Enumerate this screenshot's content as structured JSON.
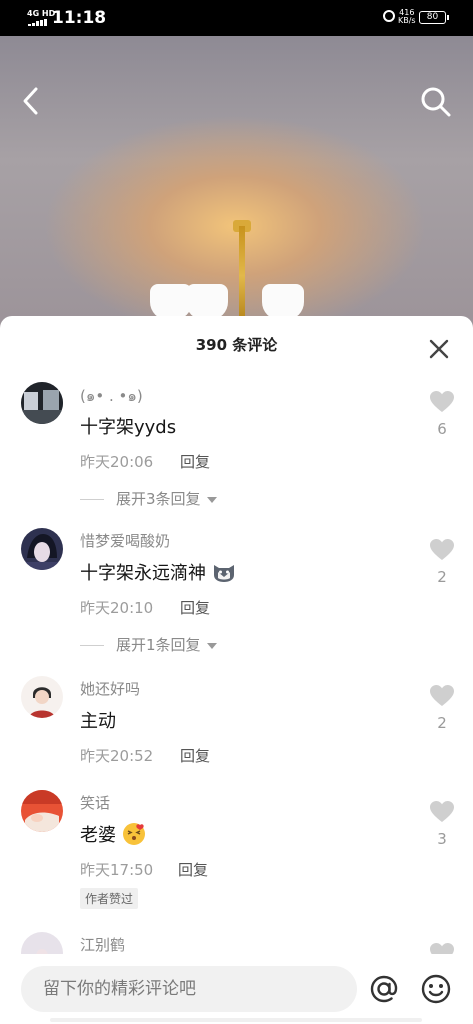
{
  "status_bar": {
    "network": "4G HD",
    "time": "11:18",
    "speed_value": "416",
    "speed_unit": "KB/s",
    "battery": "80"
  },
  "video": {
    "back_icon": "chevron-left-icon",
    "search_icon": "search-icon"
  },
  "comments_panel": {
    "title": "390 条评论",
    "close_icon": "close-icon",
    "comments": [
      {
        "username": "(๑• . •๑)",
        "text": "十字架yyds",
        "time": "昨天20:06",
        "reply_label": "回复",
        "likes": "6",
        "expand_label": "展开3条回复"
      },
      {
        "username": "惜梦爱喝酸奶",
        "text": "十字架永远滴神",
        "text_emoji": "cat-face-emoji",
        "time": "昨天20:10",
        "reply_label": "回复",
        "likes": "2",
        "expand_label": "展开1条回复"
      },
      {
        "username": "她还好吗",
        "text": "主动",
        "time": "昨天20:52",
        "reply_label": "回复",
        "likes": "2"
      },
      {
        "username": "笑话",
        "text": "老婆",
        "text_emoji": "kissing-face-emoji",
        "time": "昨天17:50",
        "reply_label": "回复",
        "likes": "3",
        "badge": "作者赞过"
      },
      {
        "username": "江别鹤"
      }
    ]
  },
  "bottom_bar": {
    "input_placeholder": "留下你的精彩评论吧",
    "at_icon": "at-icon",
    "emoji_icon": "emoji-icon"
  }
}
